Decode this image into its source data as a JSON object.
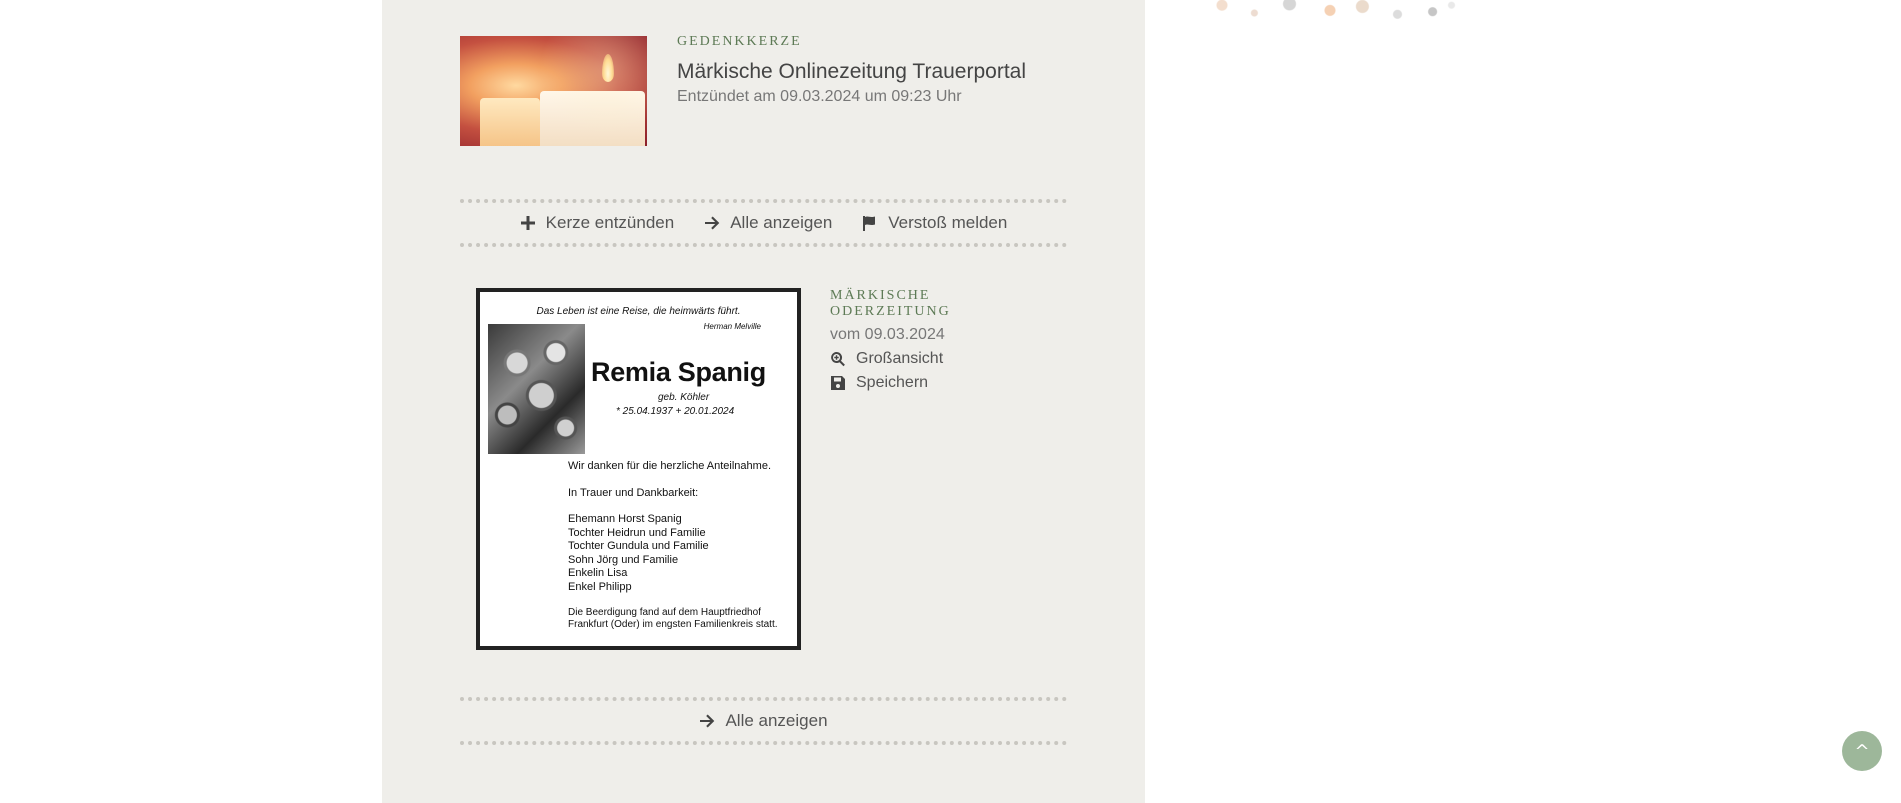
{
  "candle": {
    "eyebrow": "GEDENKKERZE",
    "title": "Märkische Onlinezeitung Trauerportal",
    "subtitle": "Entzündet am 09.03.2024 um 09:23 Uhr"
  },
  "actions_top": {
    "light_candle": "Kerze entzünden",
    "show_all": "Alle anzeigen",
    "report": "Verstoß melden"
  },
  "notice": {
    "quote": "Das Leben ist eine Reise, die heimwärts führt.",
    "quote_author": "Herman Melville",
    "name": "Remia Spanig",
    "born_name": "geb. Köhler",
    "dates": "* 25.04.1937   + 20.01.2024",
    "lines": [
      "Wir danken für die herzliche Anteilnahme.",
      "In Trauer und Dankbarkeit:",
      "Ehemann Horst Spanig",
      "Tochter Heidrun und Familie",
      "Tochter Gundula und Familie",
      "Sohn Jörg und Familie",
      "Enkelin Lisa",
      "Enkel Philipp"
    ],
    "burial": [
      "Die Beerdigung fand auf dem Hauptfriedhof",
      "Frankfurt (Oder) im engsten Familienkreis statt."
    ]
  },
  "notice_meta": {
    "publisher_line1": "MÄRKISCHE",
    "publisher_line2": "ODERZEITUNG",
    "date": "vom 09.03.2024",
    "enlarge": "Großansicht",
    "save": "Speichern"
  },
  "actions_bottom": {
    "show_all": "Alle anzeigen"
  },
  "scroll_top": "^",
  "icons": {
    "plus": "plus-icon",
    "arrow": "arrow-right-icon",
    "flag": "flag-icon",
    "zoom": "zoom-in-icon",
    "save": "floppy-disk-icon"
  },
  "colors": {
    "column_bg": "#efeeea",
    "accent_green": "#5d7a55",
    "scroll_top_bg": "#9db79a"
  }
}
